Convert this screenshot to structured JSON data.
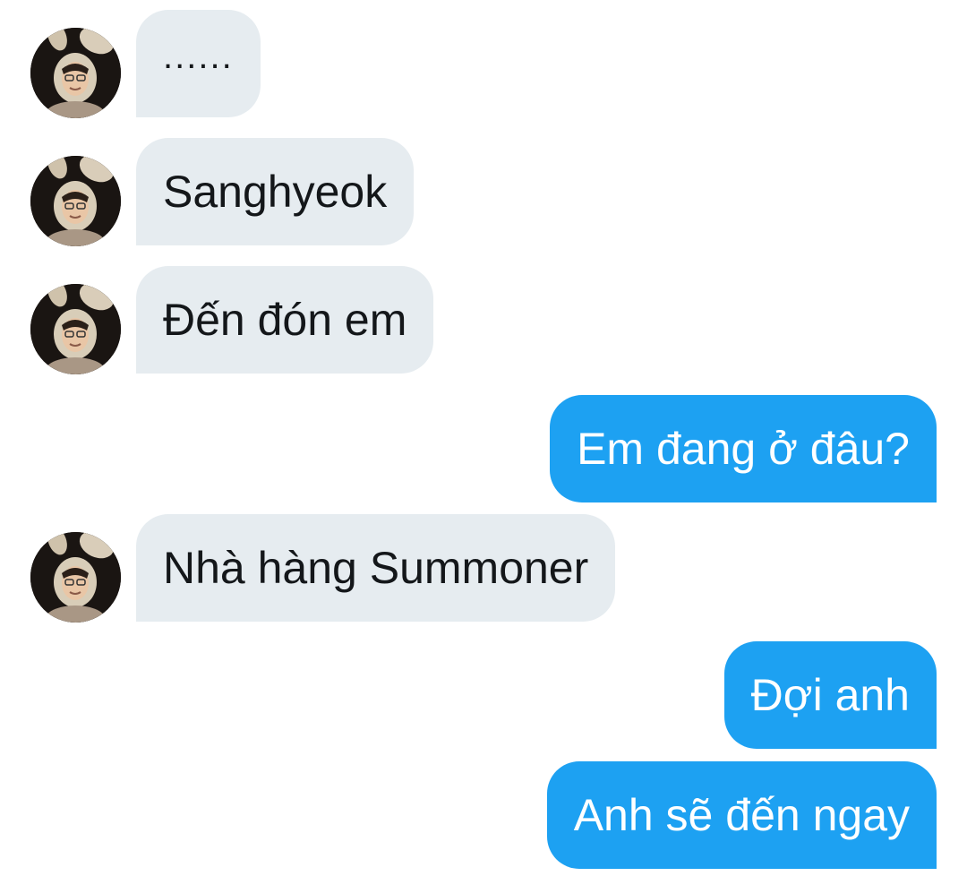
{
  "conversation": {
    "messages": [
      {
        "sender": "other",
        "text": "......"
      },
      {
        "sender": "other",
        "text": "Sanghyeok"
      },
      {
        "sender": "other",
        "text": "Đến đón em"
      },
      {
        "sender": "me",
        "text": "Em đang ở đâu?"
      },
      {
        "sender": "other",
        "text": "Nhà hàng Summoner"
      },
      {
        "sender": "me",
        "text": "Đợi anh"
      },
      {
        "sender": "me",
        "text": "Anh sẽ đến ngay"
      }
    ]
  },
  "colors": {
    "incoming_bubble": "#e6ecf0",
    "outgoing_bubble": "#1da1f2",
    "incoming_text": "#14171a",
    "outgoing_text": "#ffffff"
  },
  "icons": {
    "avatar": "bunny-ears-portrait-avatar"
  }
}
